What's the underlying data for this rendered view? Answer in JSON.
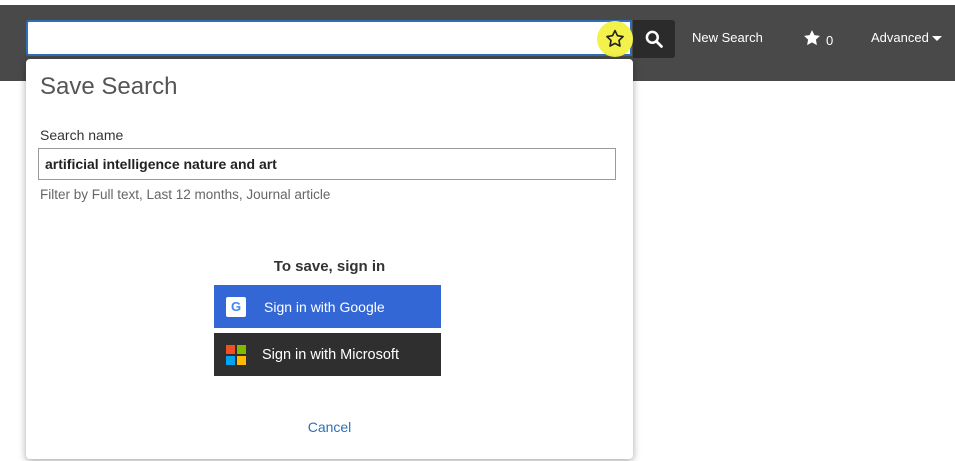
{
  "header": {
    "search": {
      "value": "",
      "placeholder": ""
    },
    "new_search_label": "New Search",
    "favorites_count": "0",
    "advanced_label": "Advanced"
  },
  "modal": {
    "title": "Save Search",
    "search_name_label": "Search name",
    "search_name_value": "artificial intelligence nature and art",
    "filter_text": "Filter by Full text, Last 12 months, Journal article",
    "signin_heading": "To save, sign in",
    "google_label": "Sign in with Google",
    "google_icon_letter": "G",
    "microsoft_label": "Sign in with Microsoft",
    "cancel_label": "Cancel"
  },
  "colors": {
    "topbar": "#4a4949",
    "accent_blue": "#2f6fb7",
    "google_blue": "#3367d6",
    "microsoft_dark": "#2f2f2f",
    "highlight_yellow": "#f2f24a",
    "ms_red": "#f25022",
    "ms_green": "#7fba00",
    "ms_blue": "#00a4ef",
    "ms_yellow": "#ffb900"
  },
  "icons": {
    "save_search": "star-outline-icon",
    "search": "magnifier-icon",
    "favorites": "star-filled-icon",
    "advanced": "caret-down-icon",
    "google": "google-g-icon",
    "microsoft": "microsoft-logo-icon"
  }
}
